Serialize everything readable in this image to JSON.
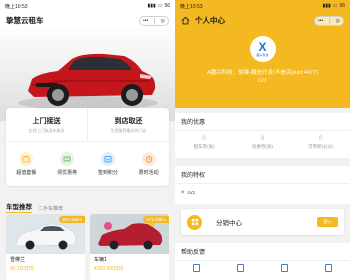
{
  "status": {
    "time": "晚上10:53",
    "battery": "56"
  },
  "left": {
    "title": "挚慧云租车",
    "services": [
      {
        "title": "上门接送",
        "sub": "在线上门取送车服务"
      },
      {
        "title": "到店取还",
        "sub": "为您推荐最近的门店"
      }
    ],
    "icons": [
      {
        "label": "超值套餐",
        "icon": "package-icon",
        "color": "#f4b821"
      },
      {
        "label": "领优惠券",
        "icon": "coupon-icon",
        "color": "#4caf50"
      },
      {
        "label": "签到积分",
        "icon": "checkin-icon",
        "color": "#2196f3"
      },
      {
        "label": "限时活动",
        "icon": "timer-icon",
        "color": "#f28b30"
      }
    ],
    "tabs": {
      "active": "车型推荐",
      "other": "二手车推荐"
    },
    "cars": [
      {
        "distance": "362.36km",
        "name": "雪佛兰",
        "price": "¥0.10/日均"
      },
      {
        "distance": "673.48km",
        "name": "车辆1",
        "price": "¥100.00/日均"
      }
    ]
  },
  "right": {
    "title": "个人中心",
    "logo_text": "X",
    "logo_sub": "趣兴科技",
    "user": "A趣兴科技、徐锋-微信开发(不是店)(uid:4477)",
    "level": "LV1",
    "coupons": {
      "title": "我的优惠",
      "stats": [
        {
          "value": "0",
          "label": "租车券(张)"
        },
        {
          "value": "0",
          "label": "优惠券(张)"
        },
        {
          "value": "0",
          "label": "可用积分(分)"
        }
      ]
    },
    "privilege": {
      "title": "我的特权",
      "level": "LV1"
    },
    "distribution": {
      "title": "分销中心",
      "button": "进入"
    },
    "help": {
      "title": "帮助反馈"
    }
  },
  "colors": {
    "accent": "#f4b821",
    "logo_blue": "#1e73d9"
  }
}
